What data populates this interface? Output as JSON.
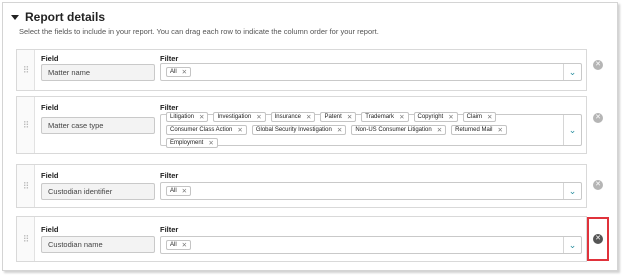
{
  "section": {
    "title": "Report details",
    "description": "Select the fields to include in your report. You can drag each row to indicate the column order for your report."
  },
  "labels": {
    "field": "Field",
    "filter": "Filter"
  },
  "rows": [
    {
      "field": "Matter name",
      "filters": [
        "All"
      ]
    },
    {
      "field": "Matter case type",
      "filters": [
        "Litigation",
        "Investigation",
        "Insurance",
        "Patent",
        "Trademark",
        "Copyright",
        "Claim",
        "Consumer Class Action",
        "Global Security Investigation",
        "Non-US Consumer Litigation",
        "Returned Mail",
        "Employment"
      ]
    },
    {
      "field": "Custodian identifier",
      "filters": [
        "All"
      ]
    },
    {
      "field": "Custodian name",
      "filters": [
        "All"
      ]
    }
  ],
  "icons": {
    "section_toggle": "caret-down-icon",
    "drag": "drag-handle-icon",
    "chip_remove": "close-icon",
    "dropdown": "chevron-down-icon",
    "row_remove": "remove-circle-icon"
  },
  "colors": {
    "highlight": "#e0323b",
    "accent": "#2a8fa0"
  }
}
